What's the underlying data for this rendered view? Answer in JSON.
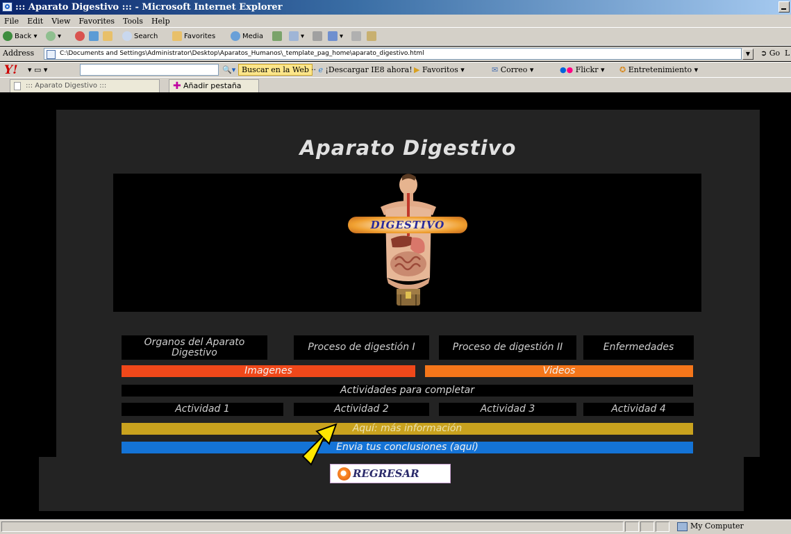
{
  "window": {
    "title": "::: Aparato Digestivo ::: - Microsoft Internet Explorer"
  },
  "menu": [
    "File",
    "Edit",
    "View",
    "Favorites",
    "Tools",
    "Help"
  ],
  "toolbar": {
    "back": "Back",
    "search": "Search",
    "favorites": "Favorites",
    "media": "Media"
  },
  "address": {
    "label": "Address",
    "url": "C:\\Documents and Settings\\Administrator\\Desktop\\Aparatos_Humanos\\_template_pag_home\\aparato_digestivo.html",
    "go": "Go",
    "links": "L"
  },
  "yahoo": {
    "logo": "Y!",
    "buscar": "Buscar en la Web",
    "descargar": "¡Descargar IE8 ahora!",
    "favoritos": "Favoritos",
    "correo": "Correo",
    "flickr": "Flickr",
    "entretenimiento": "Entretenimiento"
  },
  "tabs": {
    "current": "::: Aparato Digestivo :::",
    "new_tab": "Añadir pestaña"
  },
  "page": {
    "title": "Aparato Digestivo",
    "banner_text": "DIGESTIVO",
    "nav": [
      "Organos del Aparato Digestivo",
      "Proceso de digestión I",
      "Proceso de digestión II",
      "Enfermedades"
    ],
    "imagenes": "Imagenes",
    "videos": "Videos",
    "actividades_header": "Actividades para completar",
    "actividades": [
      "Actividad 1",
      "Actividad 2",
      "Actividad 3",
      "Actividad 4"
    ],
    "mas_info": "Aquí: más información",
    "conclusiones": "Envia tus conclusiones (aquí)",
    "regresar": "REGRESAR"
  },
  "status": {
    "zone": "My Computer"
  },
  "colors": {
    "imagenes": "#f0481a",
    "videos": "#f5761a",
    "mas_info": "#c9a21e",
    "conclusiones": "#1473d6",
    "panel": "#232323"
  }
}
